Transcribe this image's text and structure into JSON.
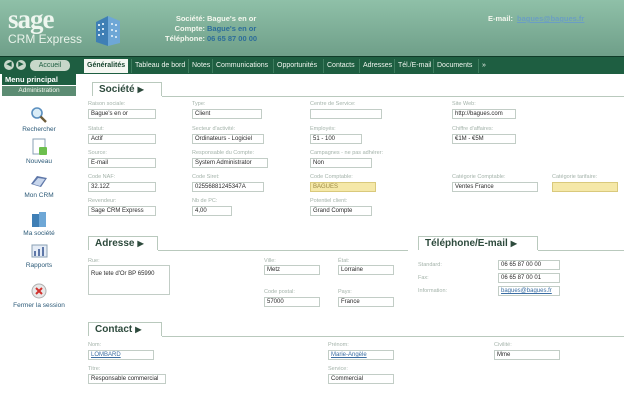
{
  "header": {
    "brand": "sage",
    "product": "CRM Express",
    "company_label": "Société:",
    "company_value": "Bague's en or",
    "account_label": "Compte:",
    "account_value": "Bague's en or",
    "phone_label": "Téléphone:",
    "phone_value": "06 65 87 00 00",
    "email_label": "E-mail:",
    "email_value": "bagues@bagues.fr"
  },
  "nav": {
    "back": "◀",
    "forward": "▶",
    "home": "Accueil",
    "tabs": [
      "Généralités",
      "Tableau de bord",
      "Notes",
      "Communications",
      "Opportunités",
      "Contacts",
      "Adresses",
      "Tél./E-mail",
      "Documents",
      "»"
    ]
  },
  "sidebar": {
    "title": "Menu principal",
    "admin": "Administration",
    "items": [
      {
        "label": "Rechercher",
        "icon": "search-icon"
      },
      {
        "label": "Nouveau",
        "icon": "new-document-icon"
      },
      {
        "label": "Mon CRM",
        "icon": "my-crm-icon"
      },
      {
        "label": "Ma société",
        "icon": "company-icon"
      },
      {
        "label": "Rapports",
        "icon": "reports-icon"
      },
      {
        "label": "Fermer la session",
        "icon": "close-session-icon"
      }
    ]
  },
  "societe": {
    "title": "Société",
    "raison_label": "Raison sociale:",
    "raison": "Bague's en or",
    "type_label": "Type:",
    "type": "Client",
    "centre_label": "Centre de Service:",
    "centre": "",
    "site_label": "Site Web:",
    "site": "http://bagues.com",
    "statut_label": "Statut:",
    "statut": "Actif",
    "secteur_label": "Secteur d'activité:",
    "secteur": "Ordinateurs - Logiciel",
    "employes_label": "Employés:",
    "employes": "51 - 100",
    "ca_label": "Chiffre d'affaires:",
    "ca": "€1M - €5M",
    "source_label": "Source:",
    "source": "E-mail",
    "responsable_label": "Responsable du Compte:",
    "responsable": "System Administrator",
    "campagnes_label": "Campagnes - ne pas adhérer:",
    "campagnes": "Non",
    "codenaf_label": "Code NAF:",
    "codenaf": "32.12Z",
    "siret_label": "Code Siret:",
    "siret": "02556881245347A",
    "comptable_label": "Code Comptable:",
    "comptable": "BAGUES",
    "catcompta_label": "Catégorie Comptable:",
    "catcompta": "Ventes France",
    "cattarif_label": "Catégorie tarifaire:",
    "cattarif": "",
    "revendeur_label": "Revendeur:",
    "revendeur": "Sage CRM Express",
    "nbpc_label": "Nb de PC:",
    "nbpc": "4,00",
    "potentiel_label": "Potentiel client:",
    "potentiel": "Grand Compte"
  },
  "adresse": {
    "title": "Adresse",
    "rue_label": "Rue:",
    "rue": "Rue tete d'Or BP 65990",
    "ville_label": "Ville:",
    "ville": "Metz",
    "etat_label": "État:",
    "etat": "Lorraine",
    "cp_label": "Code postal:",
    "cp": "57000",
    "pays_label": "Pays:",
    "pays": "France"
  },
  "telephone": {
    "title": "Téléphone/E-mail",
    "standard_label": "Standard:",
    "standard": "06 65 87 00 00",
    "fax_label": "Fax:",
    "fax": "06 65 87 00 01",
    "info_label": "Information:",
    "info": "bagues@bagues.fr"
  },
  "contact": {
    "title": "Contact",
    "nom_label": "Nom:",
    "nom": "LOMBARD",
    "prenom_label": "Prénom:",
    "prenom": "Marie-Angèle",
    "civilite_label": "Civilité:",
    "civilite": "Mme",
    "titre_label": "Titre:",
    "titre": "Responsable commercial",
    "service_label": "Service:",
    "service": "Commercial"
  }
}
